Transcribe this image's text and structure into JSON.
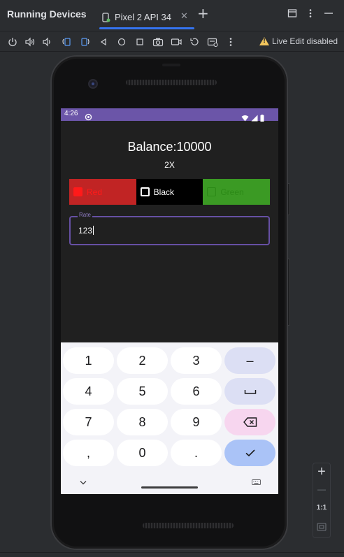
{
  "ide": {
    "tool_window_title": "Running Devices",
    "tab_label": "Pixel 2 API 34",
    "tab_close": "✕",
    "add_tab": "+",
    "live_edit_status": "Live Edit disabled",
    "toolbar_icons": [
      "power-icon",
      "volume-up-icon",
      "volume-down-icon",
      "rotate-left-icon",
      "rotate-right-icon",
      "back-icon",
      "home-icon",
      "overview-icon",
      "camera-icon",
      "screen-record-icon",
      "restore-icon",
      "snapshot-icon",
      "more-icon"
    ],
    "zoom": {
      "in": "+",
      "out": "—",
      "actual": "1:1"
    },
    "colors": {
      "bg": "#2b2d30",
      "accent": "#3574f0",
      "warning": "#f2c55c"
    }
  },
  "device": {
    "status_bar": {
      "time": "4:26",
      "bg": "#6b55a8"
    },
    "app": {
      "balance": "Balance:10000",
      "multiplier": "2X",
      "options": [
        {
          "label": "Red",
          "bg": "#c12424",
          "fg": "#ff1a1a",
          "checked": true
        },
        {
          "label": "Black",
          "bg": "#000000",
          "fg": "#ffffff",
          "checked": false
        },
        {
          "label": "Green",
          "bg": "#3b9a24",
          "fg": "#2c8a17",
          "checked": false
        }
      ],
      "rate_field": {
        "label": "Rate",
        "value": "123"
      }
    },
    "keyboard": {
      "rows": [
        [
          "1",
          "2",
          "3",
          "–"
        ],
        [
          "4",
          "5",
          "6",
          "␣"
        ],
        [
          "7",
          "8",
          "9",
          "⌫"
        ],
        [
          ",",
          "0",
          ".",
          "✓"
        ]
      ],
      "nav_hide": "⌄",
      "nav_keyboard": "⌨"
    }
  }
}
